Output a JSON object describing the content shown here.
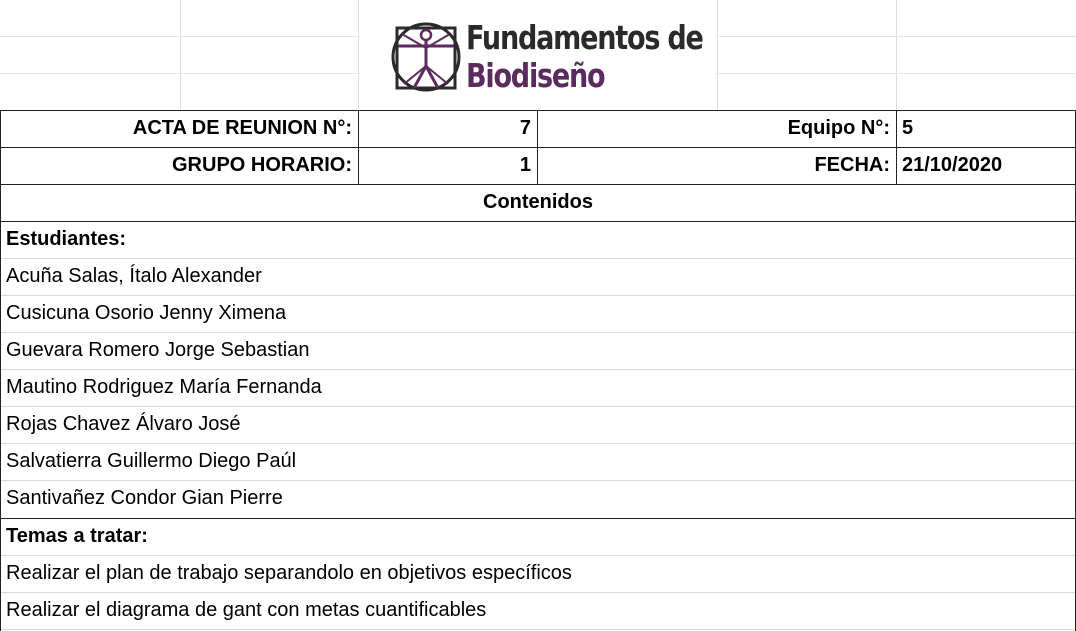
{
  "logo": {
    "line1": "Fundamentos de",
    "line2": "Biodiseño",
    "icon": "vitruvian-man-icon",
    "accent_color": "#5b2a5e"
  },
  "header": {
    "acta_label": "ACTA DE REUNION N°:",
    "acta_value": "7",
    "equipo_label": "Equipo N°:",
    "equipo_value": "5",
    "grupo_label": "GRUPO HORARIO:",
    "grupo_value": "1",
    "fecha_label": "FECHA:",
    "fecha_value": "21/10/2020"
  },
  "contenidos_title": "Contenidos",
  "estudiantes": {
    "title": "Estudiantes:",
    "items": [
      "Acuña Salas, Ítalo Alexander",
      "Cusicuna Osorio Jenny Ximena",
      "Guevara Romero Jorge Sebastian",
      "Mautino Rodriguez María Fernanda",
      "Rojas Chavez Álvaro José",
      "Salvatierra Guillermo Diego Paúl",
      "Santivañez Condor Gian Pierre"
    ]
  },
  "temas": {
    "title": "Temas a tratar:",
    "items": [
      "Realizar el plan de trabajo separandolo en objetivos específicos",
      "Realizar el diagrama de gant con metas cuantificables"
    ]
  }
}
